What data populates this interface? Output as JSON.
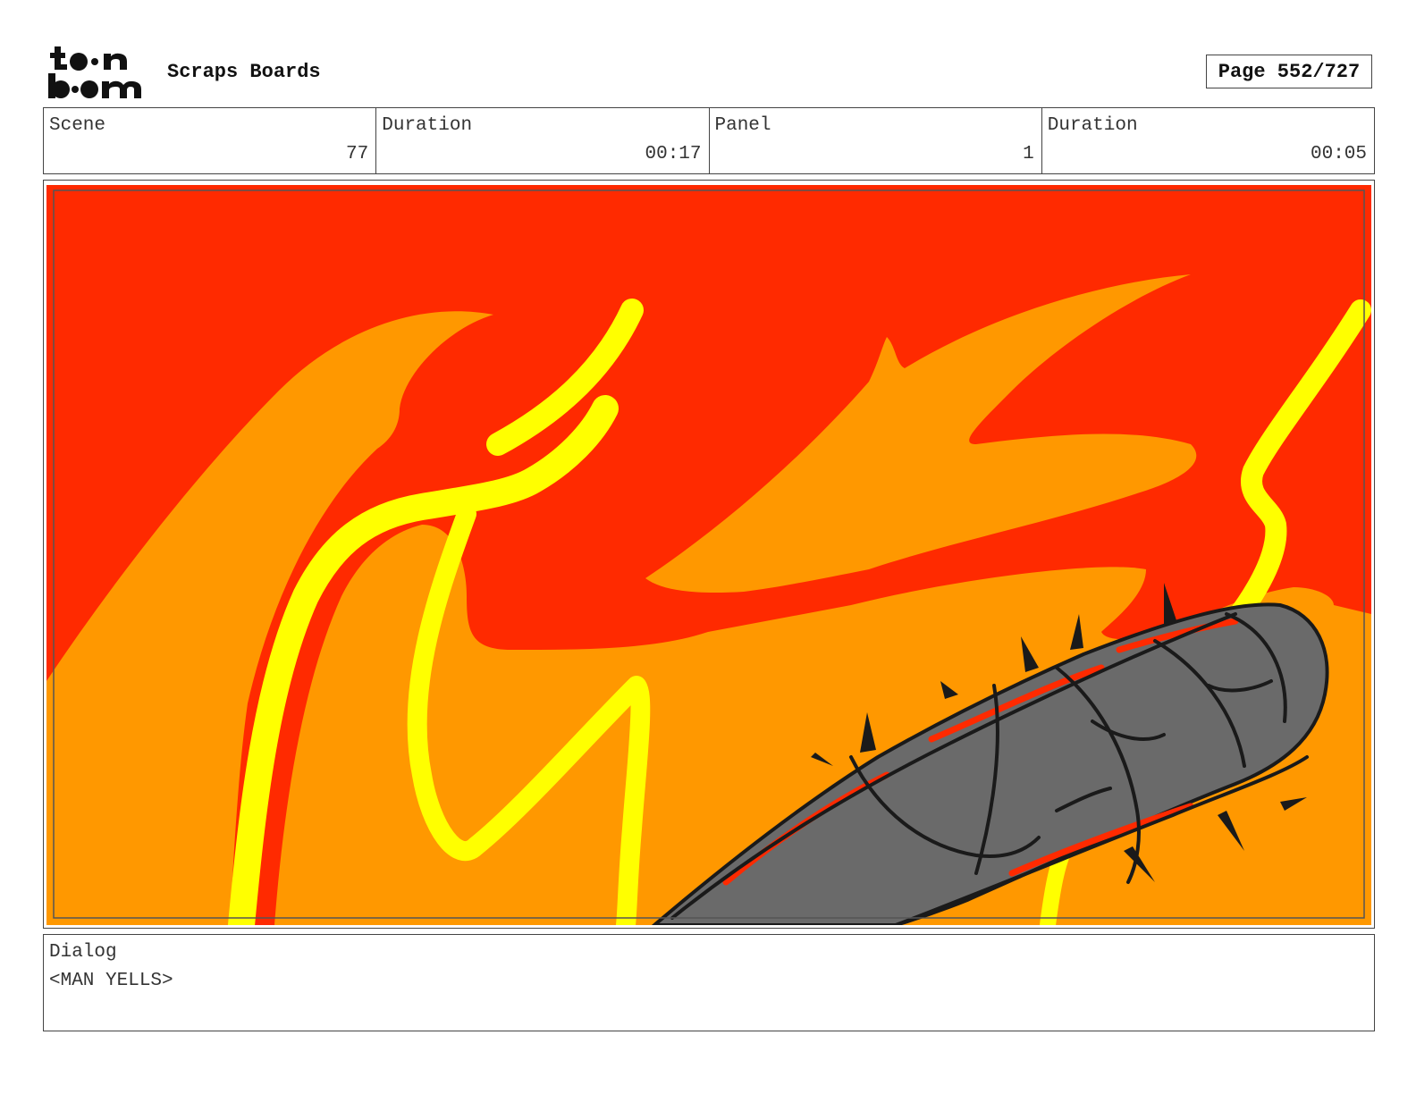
{
  "header": {
    "logo_text": "toonboom",
    "project_title": "Scraps Boards",
    "page_label": "Page 552/727"
  },
  "info": {
    "scene": {
      "label": "Scene",
      "value": "77"
    },
    "scene_duration": {
      "label": "Duration",
      "value": "00:17"
    },
    "panel": {
      "label": "Panel",
      "value": "1"
    },
    "panel_duration": {
      "label": "Duration",
      "value": "00:05"
    }
  },
  "dialog": {
    "label": "Dialog",
    "text": "<MAN YELLS>"
  },
  "colors": {
    "fire_red": "#ff2a00",
    "fire_orange": "#ff9800",
    "fire_yellow": "#ffff00",
    "bat_gray": "#6a6a6a",
    "ink": "#1a1a1a"
  }
}
